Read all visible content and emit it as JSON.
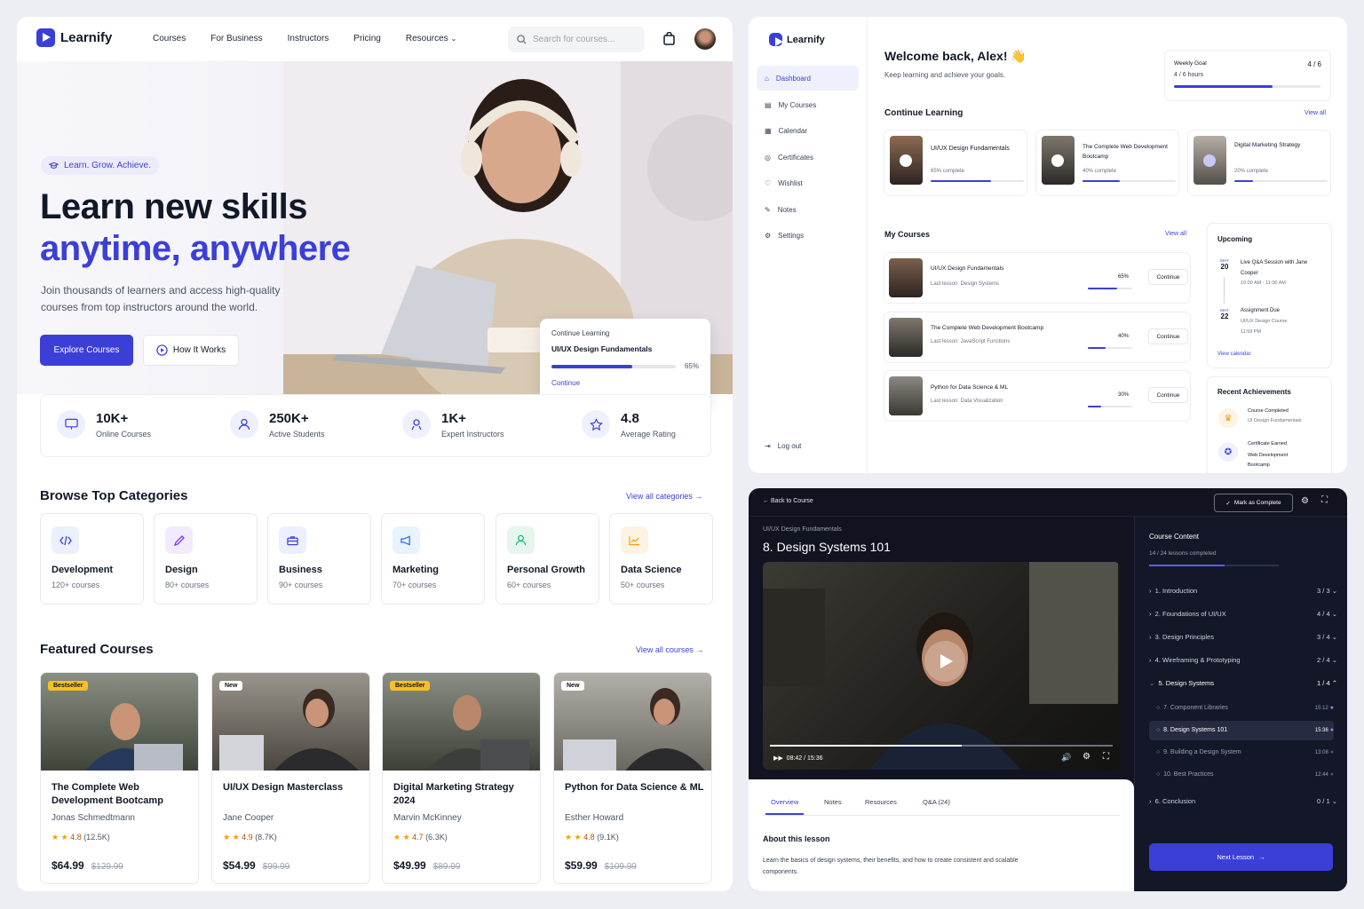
{
  "brand": "Learnify",
  "landing": {
    "nav": [
      "Courses",
      "For Business",
      "Instructors",
      "Pricing",
      "Resources"
    ],
    "search_placeholder": "Search for courses...",
    "pill": "Learn. Grow. Achieve.",
    "headline_1": "Learn new skills",
    "headline_2": "anytime, anywhere",
    "subtext": "Join thousands of learners and access high-quality courses from top instructors around the world.",
    "explore_btn": "Explore Courses",
    "how_btn": "How It Works",
    "continue_card": {
      "label": "Continue Learning",
      "course": "UI/UX Design Fundamentals",
      "percent": "65%",
      "progress": 0.65,
      "link": "Continue"
    },
    "stats": [
      {
        "value": "10K+",
        "label": "Online Courses"
      },
      {
        "value": "250K+",
        "label": "Active Students"
      },
      {
        "value": "1K+",
        "label": "Expert Instructors"
      },
      {
        "value": "4.8",
        "label": "Average Rating"
      }
    ],
    "categories_title": "Browse Top Categories",
    "categories_link": "View all categories",
    "categories": [
      {
        "name": "Development",
        "count": "120+ courses"
      },
      {
        "name": "Design",
        "count": "80+ courses"
      },
      {
        "name": "Business",
        "count": "90+ courses"
      },
      {
        "name": "Marketing",
        "count": "70+ courses"
      },
      {
        "name": "Personal Growth",
        "count": "60+ courses"
      },
      {
        "name": "Data Science",
        "count": "50+ courses"
      }
    ],
    "featured_title": "Featured Courses",
    "featured_link": "View all courses",
    "courses": [
      {
        "badge": "Bestseller",
        "title": "The Complete Web Development Bootcamp",
        "instructor": "Jonas Schmedtmann",
        "rating": "4.8",
        "reviews": "(12.5K)",
        "price": "$64.99",
        "old_price": "$129.99"
      },
      {
        "badge": "New",
        "title": "UI/UX Design Masterclass",
        "instructor": "Jane Cooper",
        "rating": "4.9",
        "reviews": "(8.7K)",
        "price": "$54.99",
        "old_price": "$99.99"
      },
      {
        "badge": "Bestseller",
        "title": "Digital Marketing Strategy 2024",
        "instructor": "Marvin McKinney",
        "rating": "4.7",
        "reviews": "(6.3K)",
        "price": "$49.99",
        "old_price": "$89.99"
      },
      {
        "badge": "New",
        "title": "Python for Data Science & ML",
        "instructor": "Esther Howard",
        "rating": "4.8",
        "reviews": "(9.1K)",
        "price": "$59.99",
        "old_price": "$109.99"
      }
    ]
  },
  "dashboard": {
    "sidebar": [
      "Dashboard",
      "My Courses",
      "Calendar",
      "Certificates",
      "Wishlist",
      "Notes",
      "Settings"
    ],
    "logout": "Log out",
    "welcome": "Welcome back, Alex! 👋",
    "welcome_sub": "Keep learning and achieve your goals.",
    "weekly_goal": {
      "label": "Weekly Goal",
      "value": "4 / 6 hours",
      "ratio": "4 / 6",
      "progress": 0.67
    },
    "continue_title": "Continue Learning",
    "continue_link": "View all",
    "continue": [
      {
        "title": "UI/UX Design Fundamentals",
        "status": "65% complete",
        "progress": 0.65
      },
      {
        "title": "The Complete Web Development Bootcamp",
        "status": "40% complete",
        "progress": 0.4
      },
      {
        "title": "Digital Marketing Strategy",
        "status": "20% complete",
        "progress": 0.2
      }
    ],
    "my_courses_title": "My Courses",
    "my_courses_link": "View all",
    "my_courses": [
      {
        "title": "UI/UX Design Fundamentals",
        "last": "Last lesson: Design Systems",
        "percent": "65%",
        "progress": 0.65,
        "btn": "Continue"
      },
      {
        "title": "The Complete Web Development Bootcamp",
        "last": "Last lesson: JavaScript Functions",
        "percent": "40%",
        "progress": 0.4,
        "btn": "Continue"
      },
      {
        "title": "Python for Data Science & ML",
        "last": "Last lesson: Data Visualization",
        "percent": "30%",
        "progress": 0.3,
        "btn": "Continue"
      }
    ],
    "upcoming_title": "Upcoming",
    "upcoming": [
      {
        "month": "MAY",
        "day": "20",
        "title": "Live Q&A Session with Jane Cooper",
        "time": "10:00 AM - 11:00 AM"
      },
      {
        "month": "MAY",
        "day": "22",
        "title": "Assignment Due",
        "sub": "UI/UX Design Course",
        "time": "11:59 PM"
      }
    ],
    "calendar_link": "View calendar",
    "achievements_title": "Recent Achievements",
    "achievements": [
      {
        "title": "Course Completed",
        "sub": "UI Design Fundamentals"
      },
      {
        "title": "Certificate Earned",
        "sub": "Web Development Bootcamp"
      }
    ]
  },
  "player": {
    "back": "Back to Course",
    "mark_complete": "Mark as Complete",
    "course": "UI/UX Design Fundamentals",
    "lesson_title": "8. Design Systems 101",
    "time": "08:42 / 15:36",
    "progress": 0.56,
    "tabs": [
      "Overview",
      "Notes",
      "Resources",
      "Q&A (24)"
    ],
    "about_title": "About this lesson",
    "about_text": "Learn the basics of design systems, their benefits, and how to create consistent and scalable components.",
    "content_title": "Course Content",
    "content_sub": "14 / 24 lessons completed",
    "content_progress": 0.58,
    "sections": [
      {
        "name": "1. Introduction",
        "count": "3 / 3"
      },
      {
        "name": "2. Foundations of UI/UX",
        "count": "4 / 4"
      },
      {
        "name": "3. Design Principles",
        "count": "3 / 4"
      },
      {
        "name": "4. Wireframing & Prototyping",
        "count": "2 / 4"
      },
      {
        "name": "5. Design Systems",
        "count": "1 / 4"
      }
    ],
    "lessons": [
      {
        "name": "7. Component Libraries",
        "dur": "15:12"
      },
      {
        "name": "8. Design Systems 101",
        "dur": "15:36"
      },
      {
        "name": "9. Building a Design System",
        "dur": "13:08"
      },
      {
        "name": "10. Best Practices",
        "dur": "12:44"
      }
    ],
    "last_section": {
      "name": "6. Conclusion",
      "count": "0 / 1"
    },
    "next_btn": "Next Lesson"
  }
}
